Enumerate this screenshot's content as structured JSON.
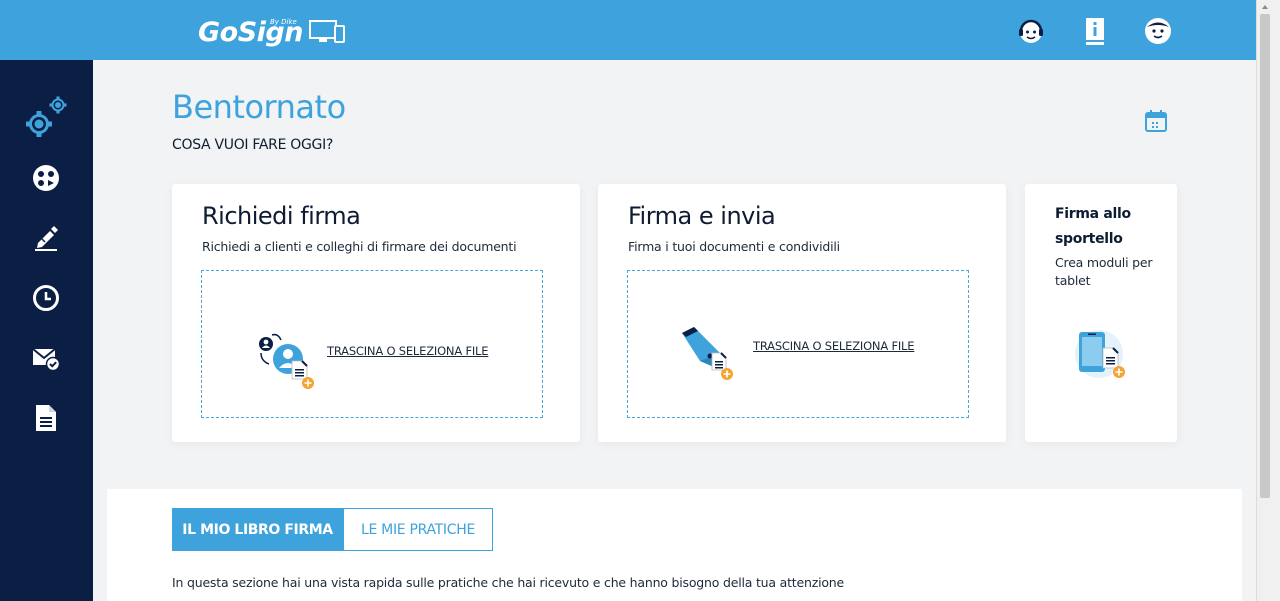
{
  "header": {
    "logo_main": "GoSign",
    "logo_by": "By Dike",
    "icons": [
      "support-icon",
      "info-icon",
      "user-icon"
    ]
  },
  "sidebar": {
    "items": [
      "settings-icon",
      "dashboard-icon",
      "sign-icon",
      "history-icon",
      "mail-check-icon",
      "document-icon"
    ]
  },
  "main": {
    "welcome": "Bentornato",
    "subtitle": "COSA VUOI FARE OGGI?"
  },
  "cards": {
    "request": {
      "title": "Richiedi firma",
      "desc": "Richiedi a clienti e colleghi di firmare dei documenti",
      "drop_label": "TRASCINA O SELEZIONA FILE"
    },
    "sign": {
      "title": "Firma e invia",
      "desc": "Firma i tuoi documenti e condividili",
      "drop_label": "TRASCINA O SELEZIONA FILE"
    },
    "counter": {
      "title": "Firma allo sportello",
      "desc": "Crea moduli per tablet"
    }
  },
  "bottom": {
    "tab_active": "IL MIO LIBRO FIRMA",
    "tab_inactive": "LE MIE PRATICHE",
    "text": "In questa sezione hai una vista rapida sulle pratiche che hai ricevuto e che hanno bisogno della tua attenzione"
  },
  "colors": {
    "primary": "#3ea3dc",
    "sidebar": "#0b1f44",
    "accent": "#f4a431"
  }
}
